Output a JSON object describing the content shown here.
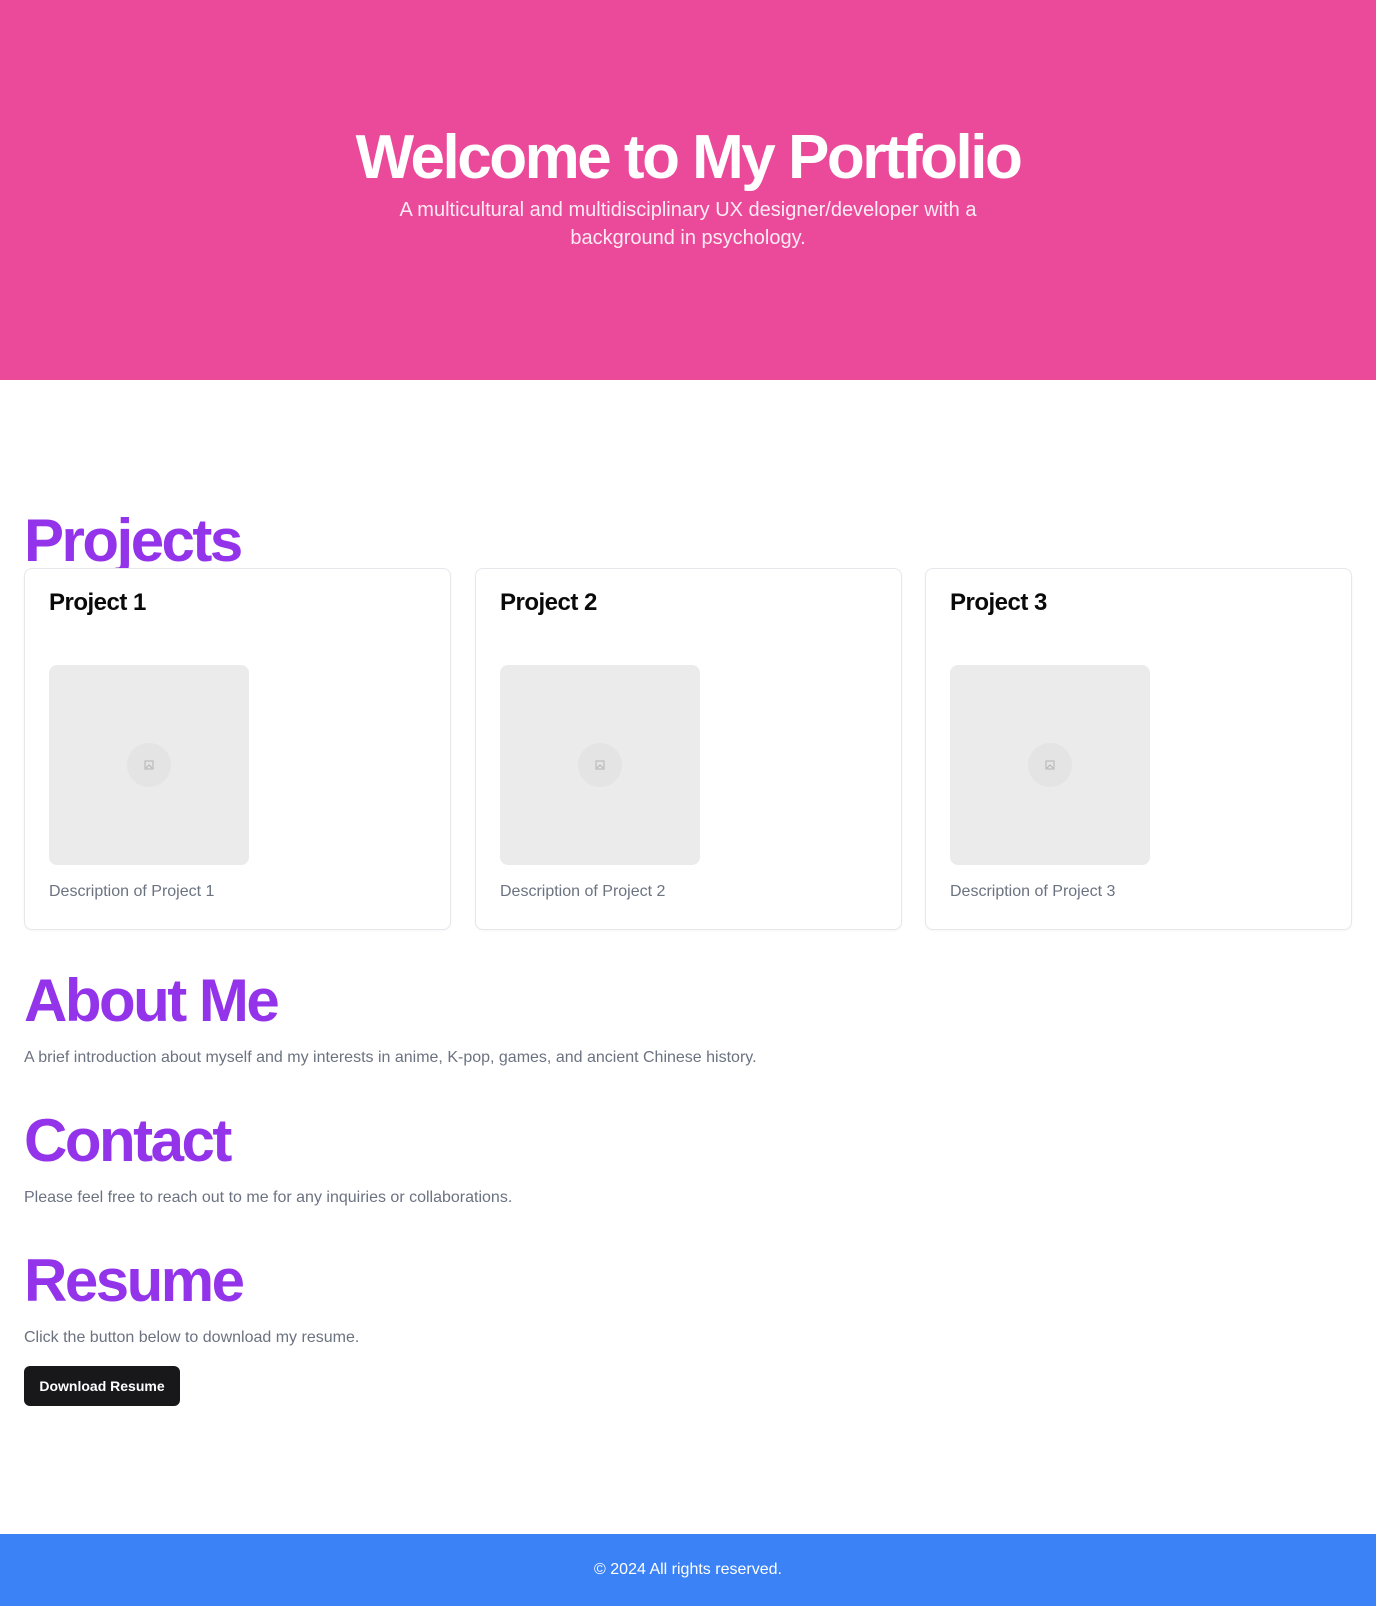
{
  "hero": {
    "title": "Welcome to My Portfolio",
    "subtitle": "A multicultural and multidisciplinary UX designer/developer with a background in psychology."
  },
  "projects": {
    "heading": "Projects",
    "items": [
      {
        "title": "Project 1",
        "description": "Description of Project 1",
        "image_icon": "image-placeholder-icon"
      },
      {
        "title": "Project 2",
        "description": "Description of Project 2",
        "image_icon": "image-placeholder-icon"
      },
      {
        "title": "Project 3",
        "description": "Description of Project 3",
        "image_icon": "image-placeholder-icon"
      }
    ]
  },
  "about": {
    "heading": "About Me",
    "text": "A brief introduction about myself and my interests in anime, K-pop, games, and ancient Chinese history."
  },
  "contact": {
    "heading": "Contact",
    "text": "Please feel free to reach out to me for any inquiries or collaborations."
  },
  "resume": {
    "heading": "Resume",
    "text": "Click the button below to download my resume.",
    "button_label": "Download Resume"
  },
  "footer": {
    "text": "© 2024 All rights reserved."
  },
  "colors": {
    "hero_bg": "#ea4a99",
    "heading": "#9333ea",
    "footer_bg": "#3b82f6",
    "button_bg": "#18181b"
  }
}
